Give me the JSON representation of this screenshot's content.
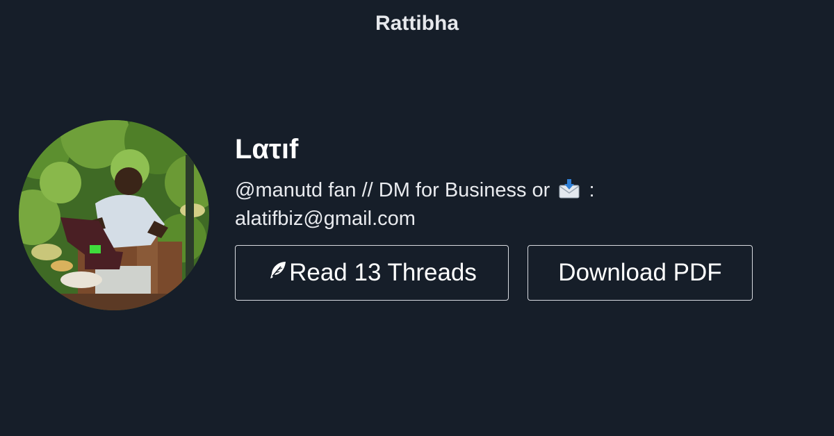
{
  "header": {
    "brand": "Rattibha"
  },
  "profile": {
    "name": "Lατıf",
    "bio_before": "@manutd fan // DM for Business or",
    "bio_after": ":",
    "bio_email": "alatifbiz@gmail.com"
  },
  "actions": {
    "read_label": "Read 13 Threads",
    "download_label": "Download PDF"
  },
  "icons": {
    "read": "feather-icon",
    "envelope": "incoming-envelope-icon"
  },
  "colors": {
    "background": "#161e29",
    "text": "#ffffff",
    "button_border": "#d9dce1"
  }
}
